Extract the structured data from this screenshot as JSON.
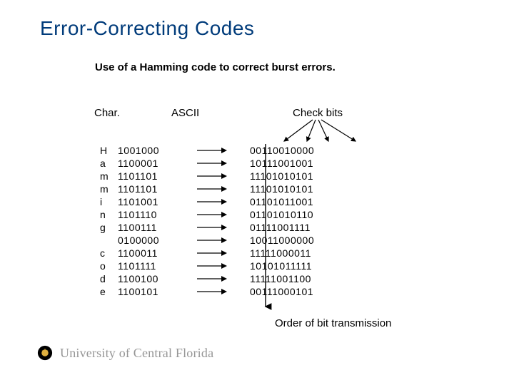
{
  "title": "Error-Correcting Codes",
  "subtitle": "Use of a Hamming code to correct burst errors.",
  "headers": {
    "char": "Char.",
    "ascii": "ASCII",
    "check": "Check bits"
  },
  "rows": [
    {
      "char": "H",
      "ascii": "1001000",
      "check": "00110010000"
    },
    {
      "char": "a",
      "ascii": "1100001",
      "check": "10111001001"
    },
    {
      "char": "m",
      "ascii": "1101101",
      "check": "11101010101"
    },
    {
      "char": "m",
      "ascii": "1101101",
      "check": "11101010101"
    },
    {
      "char": "i",
      "ascii": "1101001",
      "check": "01101011001"
    },
    {
      "char": "n",
      "ascii": "1101110",
      "check": "01101010110"
    },
    {
      "char": "g",
      "ascii": "1100111",
      "check": "01111001111"
    },
    {
      "char": "",
      "ascii": "0100000",
      "check": "10011000000"
    },
    {
      "char": "c",
      "ascii": "1100011",
      "check": "11111000011"
    },
    {
      "char": "o",
      "ascii": "1101111",
      "check": "10101011111"
    },
    {
      "char": "d",
      "ascii": "1100100",
      "check": "11111001100"
    },
    {
      "char": "e",
      "ascii": "1100101",
      "check": "00111000101"
    }
  ],
  "caption": "Order of bit transmission",
  "footer": {
    "university": "University of Central Florida"
  },
  "icons": {
    "arrow_right": "→"
  }
}
